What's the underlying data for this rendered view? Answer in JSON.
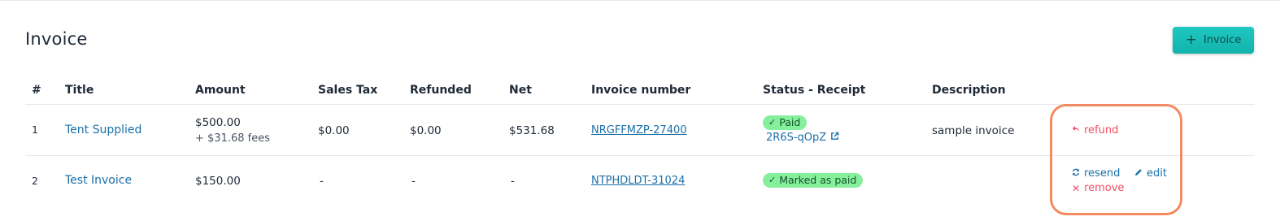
{
  "header": {
    "title": "Invoice",
    "add_button_label": "Invoice",
    "add_button_icon": "plus-icon"
  },
  "table": {
    "columns": [
      "#",
      "Title",
      "Amount",
      "Sales Tax",
      "Refunded",
      "Net",
      "Invoice number",
      "Status - Receipt",
      "Description"
    ],
    "rows": [
      {
        "num": "1",
        "title": "Tent Supplied",
        "amount": "$500.00",
        "fees": "+ $31.68 fees",
        "sales_tax": "$0.00",
        "refunded": "$0.00",
        "net": "$531.68",
        "invoice_number": "NRGFFMZP-27400",
        "status": "Paid",
        "receipt": "2R6S-qOpZ",
        "description": "sample invoice",
        "actions": {
          "refund": "refund"
        }
      },
      {
        "num": "2",
        "title": "Test Invoice",
        "amount": "$150.00",
        "sales_tax": "-",
        "refunded": "-",
        "net": "-",
        "invoice_number": "NTPHDLDT-31024",
        "status": "Marked as paid",
        "description": "",
        "actions": {
          "resend": "resend",
          "edit": "edit",
          "remove": "remove"
        }
      }
    ]
  },
  "colors": {
    "accent": "#14bdb6",
    "link": "#1b6fa8",
    "danger": "#ef4d63",
    "badge": "#86ef9c",
    "highlight": "#f48a62"
  }
}
